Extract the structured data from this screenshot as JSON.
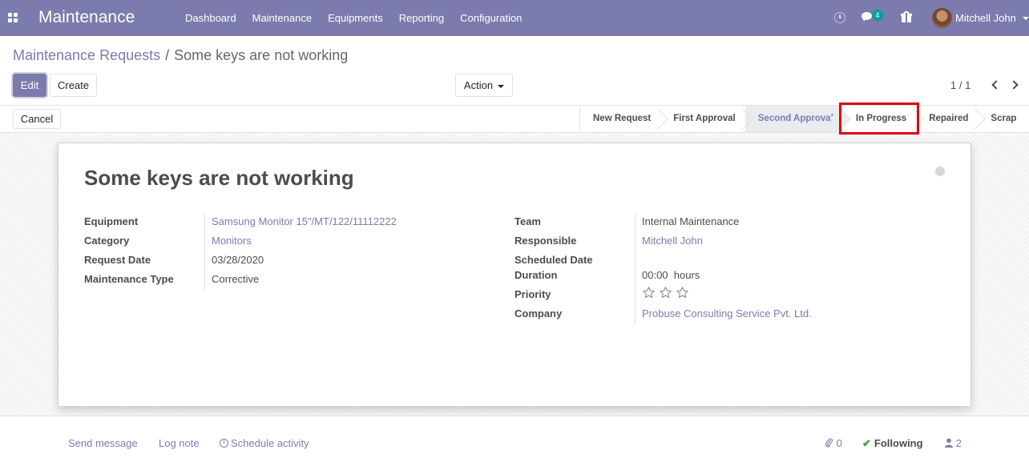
{
  "navbar": {
    "app_title": "Maintenance",
    "menu": [
      "Dashboard",
      "Maintenance",
      "Equipments",
      "Reporting",
      "Configuration"
    ],
    "messages_badge": "4",
    "user_name": "Mitchell John"
  },
  "breadcrumb": {
    "parent": "Maintenance Requests",
    "separator": "/",
    "current": "Some keys are not working"
  },
  "buttons": {
    "edit": "Edit",
    "create": "Create",
    "action": "Action",
    "cancel": "Cancel"
  },
  "pager": {
    "value": "1 / 1"
  },
  "stages": [
    {
      "label": "New Request",
      "current": false
    },
    {
      "label": "First Approval",
      "current": false
    },
    {
      "label": "Second Approval",
      "current": true
    },
    {
      "label": "In Progress",
      "current": false,
      "highlighted": true
    },
    {
      "label": "Repaired",
      "current": false
    },
    {
      "label": "Scrap",
      "current": false
    }
  ],
  "form": {
    "title": "Some keys are not working",
    "left": [
      {
        "label": "Equipment",
        "value": "Samsung Monitor 15\"/MT/122/11112222",
        "link": true
      },
      {
        "label": "Category",
        "value": "Monitors",
        "link": true
      },
      {
        "label": "Request Date",
        "value": "03/28/2020",
        "link": false
      },
      {
        "label": "Maintenance Type",
        "value": "Corrective",
        "link": false
      }
    ],
    "right": [
      {
        "label": "Team",
        "value": "Internal Maintenance",
        "link": false
      },
      {
        "label": "Responsible",
        "value": "Mitchell John",
        "link": true
      },
      {
        "label": "Scheduled Date",
        "value": "",
        "link": false
      },
      {
        "label": "Duration",
        "value": "00:00  hours",
        "link": false
      },
      {
        "label": "Priority",
        "value": "",
        "link": false
      },
      {
        "label": "Company",
        "value": "Probuse Consulting Service Pvt. Ltd.",
        "link": true
      }
    ],
    "priority_stars": 0,
    "priority_max": 3
  },
  "chatter": {
    "send_message": "Send message",
    "log_note": "Log note",
    "schedule_activity": "Schedule activity",
    "attachments": "0",
    "following": "Following",
    "followers": "2"
  },
  "colors": {
    "brand": "#7c7bad",
    "highlight": "#e0000e",
    "following_check": "#28a745"
  }
}
